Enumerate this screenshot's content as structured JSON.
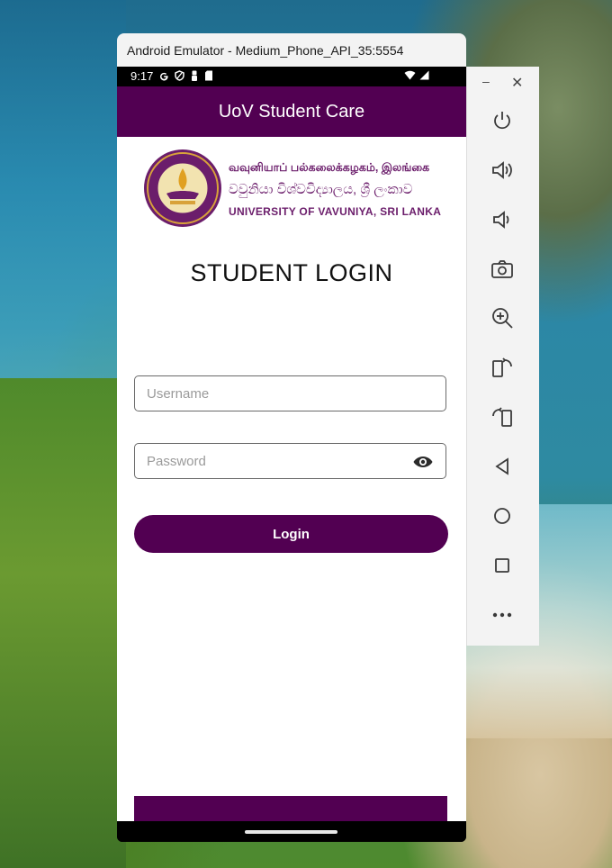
{
  "window": {
    "title": "Android Emulator - Medium_Phone_API_35:5554"
  },
  "status_bar": {
    "time": "9:17",
    "left_icons": [
      "google-g-icon",
      "shield-icon",
      "person-icon",
      "sd-card-icon"
    ],
    "right_icons": [
      "wifi-icon",
      "signal-icon"
    ]
  },
  "app_bar": {
    "title": "UoV Student Care"
  },
  "logo": {
    "line1": "வவுனியாப் பல்கலைக்கழகம், இலங்கை",
    "line2": "වවුනියා විශ්වවිද්‍යාලය, ශ්‍රී ලංකාව",
    "line3": "UNIVERSITY OF VAVUNIYA, SRI LANKA"
  },
  "login": {
    "heading": "STUDENT LOGIN",
    "username_placeholder": "Username",
    "username_value": "",
    "password_placeholder": "Password",
    "password_value": "",
    "button_label": "Login"
  },
  "toolbar": {
    "minimize": "–",
    "close": "✕",
    "buttons": [
      "power-icon",
      "volume-up-icon",
      "volume-down-icon",
      "camera-icon",
      "zoom-in-icon",
      "rotate-left-icon",
      "rotate-right-icon",
      "back-icon",
      "home-icon",
      "overview-icon",
      "more-icon"
    ]
  },
  "colors": {
    "primary": "#520052",
    "logo_text": "#6b1d6b"
  }
}
